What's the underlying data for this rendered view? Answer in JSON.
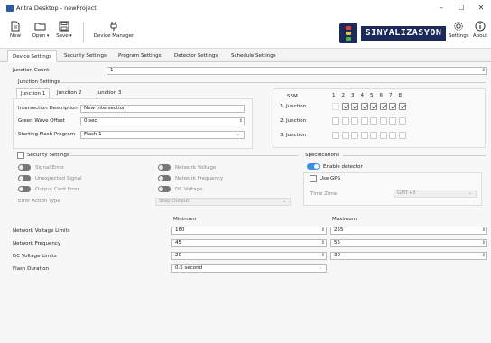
{
  "window": {
    "title": "Antra Desktop - newProject",
    "controls": [
      "–",
      "☐",
      "✕"
    ]
  },
  "toolbar": {
    "new": "New",
    "open": "Open",
    "save": "Save",
    "device_manager": "Device Manager",
    "settings": "Settings",
    "about": "About",
    "logo_text": "SINYALIZASYON"
  },
  "tabs": [
    "Device Settings",
    "Security Settings",
    "Program Settings",
    "Detector Settings",
    "Schedule Settings"
  ],
  "junction_count": {
    "label": "Junction Count",
    "value": "1"
  },
  "junction_settings": {
    "title": "Junction Settings",
    "tabs": [
      "Junction 1",
      "Junction 2",
      "Junction 3"
    ],
    "intersection_description": {
      "label": "Intersection Description",
      "value": "New Intersection"
    },
    "green_wave_offset": {
      "label": "Green Wave Offset",
      "value": "0 sec"
    },
    "starting_flash_program": {
      "label": "Starting Flash Program",
      "value": "Flash 1"
    }
  },
  "ssm": {
    "title": "SSM",
    "columns": [
      "1",
      "2",
      "3",
      "4",
      "5",
      "6",
      "7",
      "8"
    ],
    "rows": [
      {
        "label": "1. Junction",
        "checked": [
          false,
          true,
          true,
          true,
          true,
          true,
          true,
          true
        ]
      },
      {
        "label": "2. Junction",
        "checked": [
          false,
          false,
          false,
          false,
          false,
          false,
          false,
          false
        ]
      },
      {
        "label": "3. Junction",
        "checked": [
          false,
          false,
          false,
          false,
          false,
          false,
          false,
          false
        ]
      }
    ]
  },
  "security_settings": {
    "title": "Security Settings",
    "left_toggles": [
      "Signal Error",
      "Unexpected Signal",
      "Output Card Error"
    ],
    "right_toggles": [
      "Network Voltage",
      "Network Frequency",
      "DC Voltage"
    ],
    "error_action_type": {
      "label": "Error Action Type",
      "value": "Stop Output"
    }
  },
  "specifications": {
    "title": "Specifications",
    "enable_detector": "Enable detector",
    "use_gps": "Use GPS",
    "time_zone": {
      "label": "Time Zone",
      "value": "GMT+3"
    }
  },
  "limits": {
    "min_header": "Minimum",
    "max_header": "Maximum",
    "rows": [
      {
        "label": "Network Voltage Limits",
        "min": "160",
        "max": "255"
      },
      {
        "label": "Network Frequency",
        "min": "45",
        "max": "55"
      },
      {
        "label": "DC Voltage Limits",
        "min": "20",
        "max": "30"
      }
    ],
    "flash_duration": {
      "label": "Flash Duration",
      "value": "0.5 second"
    }
  }
}
